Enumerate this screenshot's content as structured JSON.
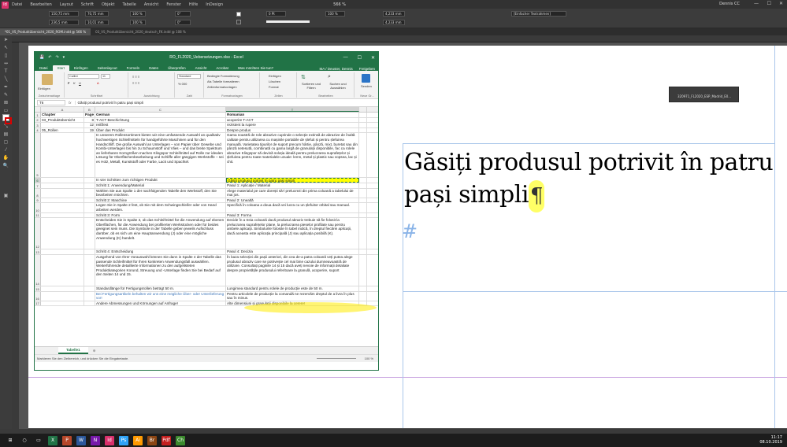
{
  "indesign": {
    "logo": "Id",
    "menu": [
      "Datei",
      "Bearbeiten",
      "Layout",
      "Schrift",
      "Objekt",
      "Tabelle",
      "Ansicht",
      "Fenster",
      "Hilfe",
      "InDesign"
    ],
    "zoom": "566 %",
    "user": "Dennis CC",
    "control": {
      "x": "150,75 mm",
      "y": "236,5 mm",
      "w": "70,75 mm",
      "h": "10,01 mm",
      "scale1": "100 %",
      "scale2": "100 %",
      "angle": "0°",
      "stroke": "0 Pt",
      "pct": "100 %",
      "offset1": "4,233 mm",
      "offset2": "4,233 mm",
      "frame_style": "[Einfacher Textrahmen]"
    },
    "doc_tabs": [
      {
        "label": "*01_VS_Produktübersicht_2020_ROM.indd @ 566 %",
        "active": true
      },
      {
        "label": "03_VS_Produktübersicht_2020_deutsch_FK.indd @ 108 %",
        "active": false
      }
    ],
    "text_frame": {
      "content": "Găsiți produsul potrivit în patru pași simpli",
      "pilcrow": "¶",
      "next": "#"
    },
    "float_panel_label": "320971_FL2020_ESP_Madrid_E0..."
  },
  "excel": {
    "title": "RO_FL2020_Uebersetzungen.xlsx - Excel",
    "quick_access": [
      "💾",
      "↶",
      "↷",
      "▾"
    ],
    "window_buttons": [
      "—",
      "☐",
      "✕"
    ],
    "tabs": [
      "Datei",
      "Start",
      "Einfügen",
      "Seitenlayout",
      "Formeln",
      "Daten",
      "Überprüfen",
      "Ansicht",
      "Acrobat"
    ],
    "active_tab": "Start",
    "tell_me": "Was möchten Sie tun?",
    "account": "MA / Deuster, Dennis",
    "share": "Freigeben",
    "ribbon": {
      "paste": "Einfügen",
      "clipboard": "Zwischenablage",
      "font_name": "Calibri",
      "font_size": "11",
      "font_group": "Schriftart",
      "align_group": "Ausrichtung",
      "number_format": "Standard",
      "number_group": "Zahl",
      "cond_format": "Bedingte Formatierung",
      "as_table": "Als Tabelle formatieren",
      "cell_styles": "Zellenformatvorlagen",
      "styles_group": "Formatvorlagen",
      "insert": "Einfügen",
      "delete": "Löschen",
      "format": "Format",
      "cells_group": "Zellen",
      "sort_filter": "Sortieren und Filtern",
      "find_select": "Suchen und Auswählen",
      "editing_group": "Bearbeiten",
      "undo": "Senden",
      "new_group": "Neue Gr..."
    },
    "name_box": "T6",
    "formula": "Găsiți produsul potrivit în patru pași simpli",
    "columns": [
      "A",
      "B",
      "C",
      "T"
    ],
    "rows": [
      {
        "n": "1",
        "a": "Chapter",
        "b": "Page",
        "c": "German",
        "d": "Romanian",
        "bold": true
      },
      {
        "n": "2",
        "a": "03_Produktübersicht",
        "b": "8",
        "c": "T-ACT Beschichtung",
        "d": "acoperire T-ACT"
      },
      {
        "n": "3",
        "a": "",
        "b": "12",
        "c": "reißfest",
        "d": "rezistent la rupere"
      },
      {
        "n": "4",
        "a": "05_Rollen",
        "b": "19",
        "c": "Über das Produkt",
        "d": "Despre produs"
      },
      {
        "n": "5",
        "a": "",
        "b": "",
        "c": "In unserem Rollensortiment bieten wir eine umfassende Auswahl an qualitativ hochwertigen Schleifmitteln für handgeführte Maschinen und für den Handschliff. Die große Auswahl an Unterlagen – von Papier über Gewebe und Kombi-Unterlagen bis hin zu Schaumstoff und Vlies – und das breite Spektrum an lieferbaren Korngrößen machen Klingspor Schleifmittel auf Rolle zur idealen Lösung für Oberflächenbearbeitung und Schliffe aller gängigen Werkstoffe – sei es Holz, Metall, Kunststoff oder Farbe, Lack und Spachtel.",
        "d": "Gama noastră de role abrazive cuprinde o selecție extinsă de abrazive de înaltă calitate pentru utilizarea cu mașinile portabile de șlefuit și pentru șlefuirea manuală. Varietatea tipurilor de suport precum hârtie, pânză, mixt, buretat sau din pânză netesută, combinată cu gama largă de granulații disponibile, fac ca rolele abrazive Klingspor să devină soluția ideală pentru prelucrarea suprafețelor și șlefuirea pentru toate materialele uzuale: lemn, metal și plastic sau vopsea, lac și chit.",
        "h": 10
      },
      {
        "n": "6",
        "a": "",
        "b": "",
        "c": "In vier Schritten zum richtigen Produkt",
        "d": "Găsiți produsul potrivit în patru pași simpli",
        "sel": true
      },
      {
        "n": "7",
        "a": "",
        "b": "",
        "c": "Schritt 1: Anwendung/Material",
        "d": "Pasul 1: Aplicație / Material"
      },
      {
        "n": "8",
        "a": "",
        "b": "",
        "c": "Wählen Sie aus Spalte 1 der nachfolgenden Tabelle den Werkstoff, den Sie bearbeiten möchten.",
        "d": "Alege materialul pe care dorești să-l prelucrezi din prima coloană a tabelului de mai jos.",
        "h": 2
      },
      {
        "n": "9",
        "a": "",
        "b": "",
        "c": "Schritt 2: Maschine",
        "d": "Pasul 2: Unealtă"
      },
      {
        "n": "10",
        "a": "",
        "b": "",
        "c": "Legen Sie in Spalte 2 fest, ob Sie mit dem Schwingschleifer oder von Hand arbeiten werden.",
        "d": "Specifică în coloana a doua dacă vei lucra cu un șlefuitor orbital sau manual.",
        "h": 2
      },
      {
        "n": "11",
        "a": "",
        "b": "",
        "c": "Schritt 3: Form",
        "d": "Pasul 3: Forma"
      },
      {
        "n": "12",
        "a": "",
        "b": "",
        "c": "Entscheiden Sie in Spalte 3, ob das Schleifmittel für die Anwendung auf ebenen Oberflächen, für die Anwendung bei profilierten Werkstücken oder für beides geeignet sein muss. Die Symbole in der Tabelle geben jeweils Aufschluss darüber, ob es sich um eine Hauptanwendung (J) oder eine mögliche Anwendung (K) handelt.",
        "d": "Decide în a treia coloană dacă produsul abraziv trebuie să fie folosit la prelucrarea suprafețelor plane, la prelucrarea pieselor profilate sau pentru ambele aplicații. Simbolurile folosite în tabel indică, în dreptul fiecărei aplicații, dacă aceasta este aplicația principală (J) sau aplicația posibilă (K).",
        "h": 7
      },
      {
        "n": "13",
        "a": "",
        "b": "",
        "c": "Schritt 4: Entscheidung",
        "d": "Pasul 4: Decizia"
      },
      {
        "n": "14",
        "a": "",
        "b": "",
        "c": "Ausgehend von Ihrer Vorauswahl können Sie dann in Spalte 4 der Tabelle das passende Schleifmittel für Ihren konkreten Anwendungsfall auswählen. Weiterführende detaillierte Informationen zu den aufgelisteten Produktkategorien Korund, Streuung und -Unterlage finden Sie bei Bedarf auf den Seiten 14 und 15.",
        "d": "În baza selecției din pașii anteriori, din cea de-a patra coloană veți putea alege produsul abraziv care se potrivește cel mai bine cazului dumneavoastră de utilizare. Consultați paginile 14 și 15 dacă aveți nevoie de informații detaliate despre proprietățile produsului referitoare la granulă, acoperire, suport",
        "h": 7
      },
      {
        "n": "15",
        "a": "",
        "b": "",
        "c": "Standardlänge für Fertigungsrollen beträgt 50 m.",
        "d": "Lungimea standard pentru rolele de producție este de 50 m."
      },
      {
        "n": "16",
        "a": "",
        "b": "",
        "c": "Bei Fertigungsartikeln behalten wir uns eine mögliche Über- oder Unterlieferung vor!",
        "d": "Pentru articolele de producție la comandă ne rezervăm dreptul de a livra în plus sau în minus.",
        "h": 2,
        "link": true
      },
      {
        "n": "17",
        "a": "",
        "b": "",
        "c": "Andere Abmessungen und Körnungen auf Anfrage!",
        "d": "Alte dimensiuni și granulații disponibile la cerere!"
      }
    ],
    "sheet_tab": "Tabelle1",
    "status_msg": "Markieren Sie den Zielbereich, und drücken Sie die Eingabetaste.",
    "zoom": "100 %"
  },
  "taskbar": {
    "time": "11:17",
    "date": "08.10.2019",
    "apps": [
      "⊞",
      "○",
      "▭",
      "X",
      "P",
      "W",
      "N",
      "Id",
      "Ps",
      "Ai",
      "Br",
      "Pdf",
      "Ch"
    ],
    "app_colors": [
      "#1c1c1c",
      "#1c1c1c",
      "#1c1c1c",
      "#217346",
      "#b7472a",
      "#2b579a",
      "#7719aa",
      "#d9306b",
      "#2fa3f7",
      "#ff9a00",
      "#8b4513",
      "#c41e1e",
      "#3c8a2e"
    ]
  }
}
